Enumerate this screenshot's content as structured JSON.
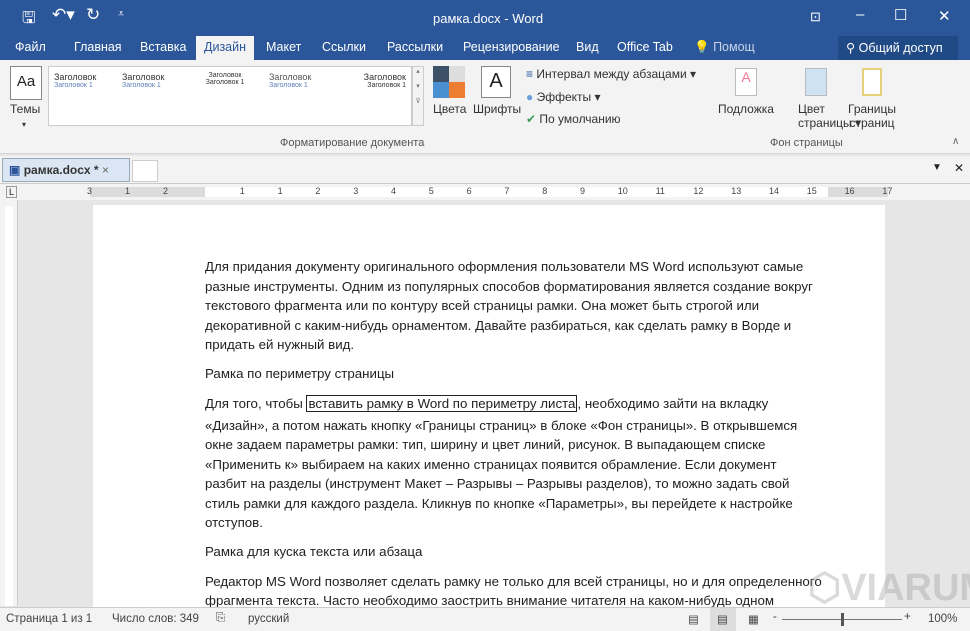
{
  "window": {
    "title": "рамка.docx - Word"
  },
  "qat": {
    "save": "save-icon",
    "undo": "undo-icon",
    "redo": "redo-icon"
  },
  "tabs": [
    "Файл",
    "Главная",
    "Вставка",
    "Дизайн",
    "Макет",
    "Ссылки",
    "Рассылки",
    "Рецензирование",
    "Вид",
    "Office Tab"
  ],
  "active_tab": "Дизайн",
  "tell_me": "Помощ",
  "share": "Общий доступ",
  "ribbon": {
    "themes": "Темы",
    "gallery_heading": "Заголовок",
    "gallery_subheading": "Заголовок 1",
    "colors": "Цвета",
    "fonts": "Шрифты",
    "fonts_glyph": "A",
    "themes_glyph": "Aa",
    "para_spacing": "Интервал между абзацами",
    "effects": "Эффекты",
    "default": "По умолчанию",
    "group_format": "Форматирование документа",
    "watermark": "Подложка",
    "page_color_1": "Цвет",
    "page_color_2": "страницы",
    "borders_1": "Границы",
    "borders_2": "страниц",
    "group_bg": "Фон страницы"
  },
  "doc_tab": "рамка.docx *",
  "ruler_labels": [
    "3",
    "1",
    "2",
    "1",
    "1",
    "2",
    "3",
    "4",
    "5",
    "6",
    "7",
    "8",
    "9",
    "10",
    "11",
    "12",
    "13",
    "14",
    "15",
    "16",
    "17"
  ],
  "document": {
    "lines": [
      "Для придания документу оригинального оформления пользователи MS Word используют самые",
      "разные инструменты. Одним из популярных способов форматирования является создание вокруг",
      "текстового фрагмента или по контуру всей страницы рамки. Она может быть строгой или",
      "декоративной с каким-нибудь орнаментом. Давайте разбираться, как сделать рамку в Ворде и",
      "придать ей нужный вид.",
      "Рамка по периметру страницы",
      "Для того, чтобы ",
      "вставить рамку в Word по периметру листа",
      ", необходимо зайти на вкладку",
      "«Дизайн», а потом нажать кнопку «Границы страниц» в блоке «Фон страницы». В открывшемся",
      "окне задаем параметры рамки: тип, ширину и цвет линий, рисунок. В выпадающем списке",
      "«Применить к» выбираем на каких именно страницах появится обрамление. Если документ",
      "разбит на разделы (инструмент Макет – Разрывы – Разрывы разделов), то можно задать свой",
      "стиль рамки для каждого раздела. Кликнув по кнопке «Параметры», вы перейдете к настройке",
      "отступов.",
      "Рамка для куска текста или абзаца",
      "Редактор MS Word позволяет сделать рамку не только для всей страницы, но и для определенного",
      "фрагмента текста. Часто необходимо заострить внимание читателя на каком-нибудь одном"
    ]
  },
  "watermark_text": "VIARUM",
  "status": {
    "page": "Страница 1 из 1",
    "words": "Число слов: 349",
    "language": "русский",
    "zoom": "100%",
    "zoom_percent": 100
  },
  "colors": {
    "accent": "#2b579a",
    "ribbon": "#f3f3f3"
  }
}
